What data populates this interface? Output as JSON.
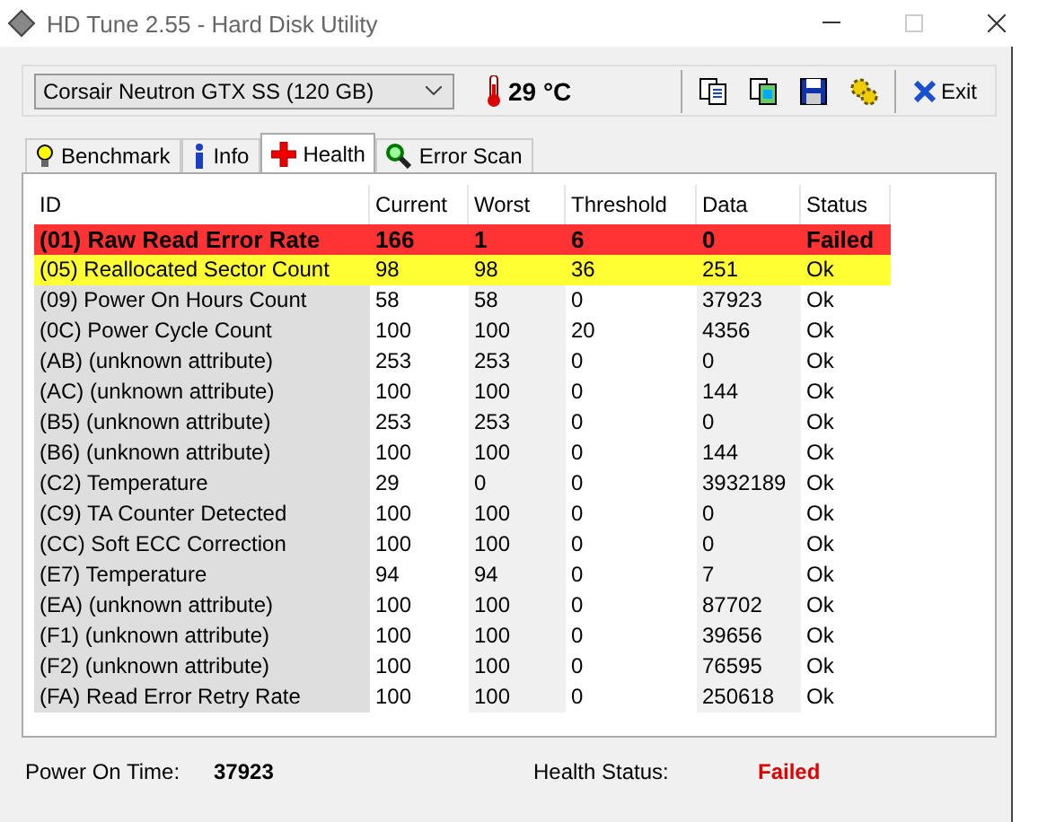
{
  "window": {
    "title": "HD Tune 2.55 - Hard Disk Utility"
  },
  "drive": {
    "value": "Corsair Neutron GTX SS (120 GB)"
  },
  "temperature": "29 °C",
  "exit_button": {
    "label": "Exit"
  },
  "tabs": [
    {
      "label": "Benchmark",
      "kind": "bulb",
      "selected": false
    },
    {
      "label": "Info",
      "kind": "info",
      "selected": false
    },
    {
      "label": "Health",
      "kind": "cross",
      "selected": true
    },
    {
      "label": "Error Scan",
      "kind": "magnifier",
      "selected": false
    }
  ],
  "table": {
    "columns": [
      "ID",
      "Current",
      "Worst",
      "Threshold",
      "Data",
      "Status"
    ],
    "rows": [
      {
        "kind": "failed",
        "cells": [
          "(01) Raw Read Error Rate",
          "166",
          "1",
          "6",
          "0",
          "Failed"
        ]
      },
      {
        "kind": "warning",
        "cells": [
          "(05) Reallocated Sector Count",
          "98",
          "98",
          "36",
          "251",
          "Ok"
        ]
      },
      {
        "kind": "normal",
        "cells": [
          "(09) Power On Hours Count",
          "58",
          "58",
          "0",
          "37923",
          "Ok"
        ]
      },
      {
        "kind": "normal",
        "cells": [
          "(0C) Power Cycle Count",
          "100",
          "100",
          "20",
          "4356",
          "Ok"
        ]
      },
      {
        "kind": "normal",
        "cells": [
          "(AB) (unknown attribute)",
          "253",
          "253",
          "0",
          "0",
          "Ok"
        ]
      },
      {
        "kind": "normal",
        "cells": [
          "(AC) (unknown attribute)",
          "100",
          "100",
          "0",
          "144",
          "Ok"
        ]
      },
      {
        "kind": "normal",
        "cells": [
          "(B5) (unknown attribute)",
          "253",
          "253",
          "0",
          "0",
          "Ok"
        ]
      },
      {
        "kind": "normal",
        "cells": [
          "(B6) (unknown attribute)",
          "100",
          "100",
          "0",
          "144",
          "Ok"
        ]
      },
      {
        "kind": "normal",
        "cells": [
          "(C2) Temperature",
          "29",
          "0",
          "0",
          "3932189",
          "Ok"
        ]
      },
      {
        "kind": "normal",
        "cells": [
          "(C9) TA Counter Detected",
          "100",
          "100",
          "0",
          "0",
          "Ok"
        ]
      },
      {
        "kind": "normal",
        "cells": [
          "(CC) Soft ECC Correction",
          "100",
          "100",
          "0",
          "0",
          "Ok"
        ]
      },
      {
        "kind": "normal",
        "cells": [
          "(E7) Temperature",
          "94",
          "94",
          "0",
          "7",
          "Ok"
        ]
      },
      {
        "kind": "normal",
        "cells": [
          "(EA) (unknown attribute)",
          "100",
          "100",
          "0",
          "87702",
          "Ok"
        ]
      },
      {
        "kind": "normal",
        "cells": [
          "(F1) (unknown attribute)",
          "100",
          "100",
          "0",
          "39656",
          "Ok"
        ]
      },
      {
        "kind": "normal",
        "cells": [
          "(F2) (unknown attribute)",
          "100",
          "100",
          "0",
          "76595",
          "Ok"
        ]
      },
      {
        "kind": "normal",
        "cells": [
          "(FA) Read Error Retry Rate",
          "100",
          "100",
          "0",
          "250618",
          "Ok"
        ]
      }
    ]
  },
  "footer": {
    "power_on_label": "Power On Time:",
    "power_on_value": "37923",
    "health_label": "Health Status:",
    "health_value": "Failed"
  }
}
